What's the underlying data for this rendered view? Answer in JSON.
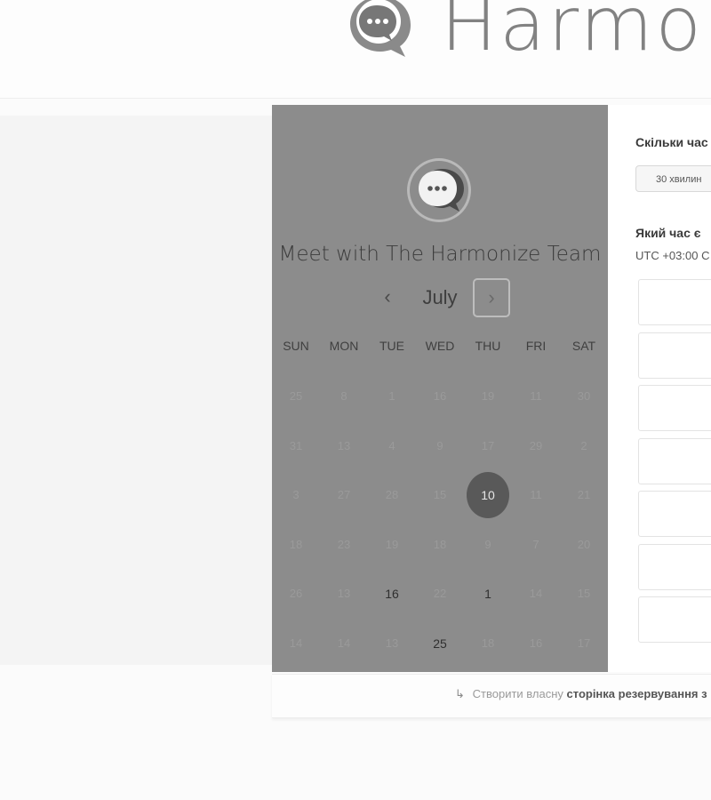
{
  "header": {
    "brand_text": "Harmo",
    "logo_icon": "speech-bubble-logo-icon"
  },
  "calendar": {
    "title": "Meet with The Harmonize Team",
    "month": "July",
    "prev_icon": "‹",
    "next_icon": "›",
    "weekdays": [
      "SUN",
      "MON",
      "TUE",
      "WED",
      "THU",
      "FRI",
      "SAT"
    ],
    "weeks": [
      [
        {
          "d": "25",
          "avail": false
        },
        {
          "d": "8",
          "avail": false
        },
        {
          "d": "1",
          "avail": false
        },
        {
          "d": "16",
          "avail": false
        },
        {
          "d": "19",
          "avail": false
        },
        {
          "d": "11",
          "avail": false
        },
        {
          "d": "30",
          "avail": false
        }
      ],
      [
        {
          "d": "31",
          "avail": false
        },
        {
          "d": "13",
          "avail": false
        },
        {
          "d": "4",
          "avail": false
        },
        {
          "d": "9",
          "avail": false
        },
        {
          "d": "17",
          "avail": false
        },
        {
          "d": "29",
          "avail": false
        },
        {
          "d": "2",
          "avail": false
        }
      ],
      [
        {
          "d": "3",
          "avail": false
        },
        {
          "d": "27",
          "avail": false
        },
        {
          "d": "28",
          "avail": false
        },
        {
          "d": "15",
          "avail": false
        },
        {
          "d": "10",
          "avail": true,
          "selected": true
        },
        {
          "d": "11",
          "avail": false
        },
        {
          "d": "21",
          "avail": false
        }
      ],
      [
        {
          "d": "18",
          "avail": false
        },
        {
          "d": "23",
          "avail": false
        },
        {
          "d": "19",
          "avail": false
        },
        {
          "d": "18",
          "avail": false
        },
        {
          "d": "9",
          "avail": false
        },
        {
          "d": "7",
          "avail": false
        },
        {
          "d": "20",
          "avail": false
        }
      ],
      [
        {
          "d": "26",
          "avail": false
        },
        {
          "d": "13",
          "avail": false
        },
        {
          "d": "16",
          "avail": true
        },
        {
          "d": "22",
          "avail": false
        },
        {
          "d": "1",
          "avail": true
        },
        {
          "d": "14",
          "avail": false
        },
        {
          "d": "15",
          "avail": false
        }
      ],
      [
        {
          "d": "14",
          "avail": false
        },
        {
          "d": "14",
          "avail": false
        },
        {
          "d": "13",
          "avail": false
        },
        {
          "d": "25",
          "avail": true
        },
        {
          "d": "18",
          "avail": false
        },
        {
          "d": "16",
          "avail": false
        },
        {
          "d": "17",
          "avail": false
        }
      ]
    ]
  },
  "booking": {
    "duration_question": "Скільки час",
    "duration_option": "30 хвилин",
    "time_question": "Який час є",
    "timezone": "UTC +03:00 C",
    "slots": [
      "",
      "",
      "",
      "",
      "",
      "",
      ""
    ]
  },
  "footer": {
    "icon": "↳",
    "prefix": "Створити власну",
    "link": "сторінка резервування з"
  }
}
